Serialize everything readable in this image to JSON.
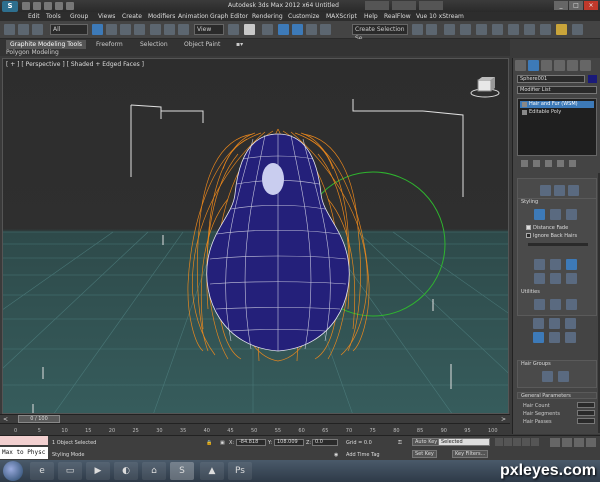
{
  "window": {
    "title": "Autodesk 3ds Max  2012 x64     Untitled"
  },
  "menu": [
    "Edit",
    "Tools",
    "Group",
    "Views",
    "Create",
    "Modifiers",
    "Animation",
    "Graph Editor",
    "Rendering",
    "Customize",
    "MAXScript",
    "Help",
    "RealFlow",
    "Vue 10 xStream"
  ],
  "toolbar": {
    "selection_filter": "All",
    "ref_coord": "View",
    "named_selection": "Create Selection Se"
  },
  "ribbon": {
    "tabs": [
      "Graphite Modeling Tools",
      "Freeform",
      "Selection",
      "Object Paint"
    ],
    "active_tab": "Graphite Modeling Tools",
    "sub_label": "Polygon Modeling"
  },
  "viewport": {
    "label": "[ + ] [ Perspective ] [ Shaded + Edged Faces ]"
  },
  "command_panel": {
    "object_name": "Sphere001",
    "modifier_list": "Modifier List",
    "stack": [
      "Hair and Fur (WSM)",
      "Editable Poly"
    ],
    "styling": {
      "title": "Styling",
      "distance_fade": "Distance Fade",
      "ignore_back_hairs": "Ignore Back Hairs",
      "distance_fade_checked": true,
      "ignore_back_hairs_checked": false
    },
    "utilities_title": "Utilities",
    "hair_groups_title": "Hair Groups",
    "general_parameters": {
      "title": "General Parameters",
      "rows": [
        "Hair Count",
        "Hair Segments",
        "Hair Passes"
      ]
    }
  },
  "timeline": {
    "thumb": "0 / 100",
    "ticks": [
      "0",
      "5",
      "10",
      "15",
      "20",
      "25",
      "30",
      "35",
      "40",
      "45",
      "50",
      "55",
      "60",
      "65",
      "70",
      "75",
      "80",
      "85",
      "90",
      "95",
      "100"
    ]
  },
  "status": {
    "maxscript_line1": "",
    "maxscript_line2": "Max to Physc",
    "objects_selected": "1 Object Selected",
    "prompt": "Styling Mode",
    "x_label": "X:",
    "x_value": "-84.818",
    "y_label": "Y:",
    "y_value": "108.009",
    "z_label": "Z:",
    "z_value": "0.0",
    "grid": "Grid = 0.0",
    "add_time_tag": "Add Time Tag",
    "auto_key": "Auto Key",
    "selected": "Selected",
    "set_key": "Set Key",
    "key_filters": "Key Filters..."
  },
  "taskbar": {
    "watermark": "pxleyes.com"
  }
}
